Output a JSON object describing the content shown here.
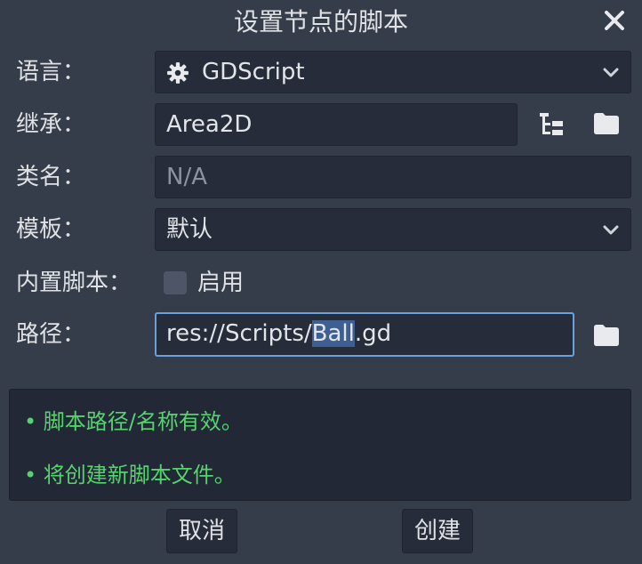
{
  "dialog": {
    "title": "设置节点的脚本",
    "close_icon": "close-icon"
  },
  "language": {
    "label": "语言：",
    "value": "GDScript",
    "icon": "gear-icon"
  },
  "inherits": {
    "label": "继承：",
    "value": "Area2D"
  },
  "class_name": {
    "label": "类名：",
    "placeholder": "N/A"
  },
  "template": {
    "label": "模板：",
    "value": "默认"
  },
  "builtin": {
    "label": "内置脚本：",
    "checkbox_label": "启用",
    "checked": false
  },
  "path": {
    "label": "路径：",
    "prefix": "res://Scripts/",
    "selected": "Ball",
    "suffix": ".gd"
  },
  "messages": [
    "• 脚本路径/名称有效。",
    "• 将创建新脚本文件。"
  ],
  "buttons": {
    "cancel": "取消",
    "create": "创建"
  },
  "colors": {
    "background": "#363d4a",
    "field": "#262c3a",
    "success_text": "#55d46d",
    "focus_border": "#6aa1dd"
  }
}
